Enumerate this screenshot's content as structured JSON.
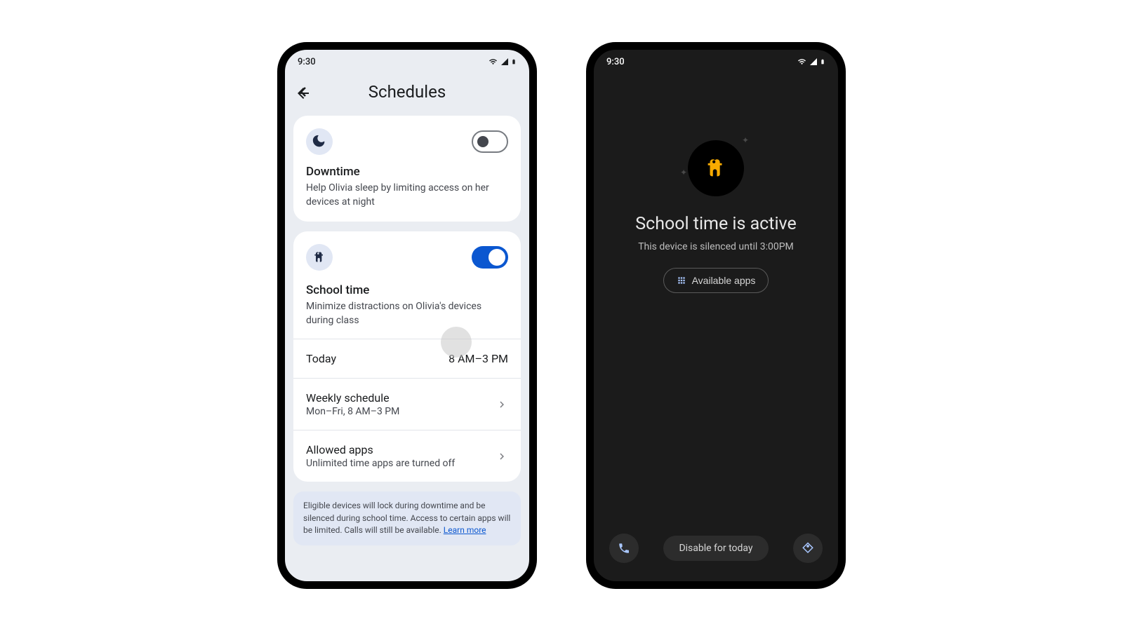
{
  "phone1": {
    "status": {
      "time": "9:30"
    },
    "appbar": {
      "title": "Schedules"
    },
    "downtime": {
      "title": "Downtime",
      "desc": "Help Olivia sleep by limiting access on her devices at night",
      "toggle": false
    },
    "schooltime": {
      "title": "School time",
      "desc": "Minimize distractions on Olivia's devices during class",
      "toggle": true,
      "today_label": "Today",
      "today_value": "8 AM–3 PM",
      "weekly_label": "Weekly schedule",
      "weekly_value": "Mon–Fri, 8 AM–3 PM",
      "allowed_label": "Allowed apps",
      "allowed_value": "Unlimited time apps are turned off"
    },
    "info": {
      "text": "Eligible devices will lock during downtime and be silenced during school time. Access to certain apps will be limited. Calls will still be available. ",
      "link": "Learn more"
    }
  },
  "phone2": {
    "status": {
      "time": "9:30"
    },
    "hero": {
      "title": "School time is active",
      "subtitle": "This device is silenced until 3:00PM",
      "button": "Available apps"
    },
    "bottom": {
      "disable": "Disable for today"
    }
  }
}
